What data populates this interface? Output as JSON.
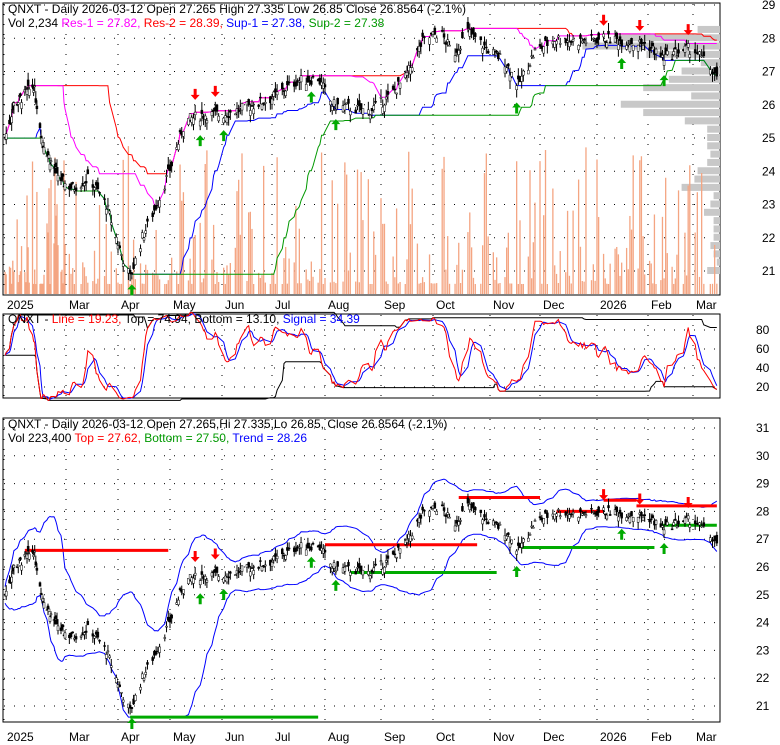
{
  "ticker": "QNXT",
  "panel1": {
    "line1": "QNXT - Daily 2026-03-12 Open 27.265  High 27.335  Low 26.85  Close 26.8564 (-2.1%)",
    "vol": "Vol 2,234 ",
    "res1": "Res-1 = 27.82, ",
    "res2": "Res-2 = 28.39, ",
    "sup1": "Sup-1 = 27.38, ",
    "sup2": "Sup-2 = 27.38",
    "yticks": [
      "29",
      "28",
      "27",
      "26",
      "25",
      "24",
      "23",
      "22",
      "21"
    ]
  },
  "panel2": {
    "name": "QNXT - ",
    "line": "Line = 19.23, ",
    "top": "Top = 74.94, ",
    "bottom": "Bottom = 13.10, ",
    "signal": "Signal = 34.39",
    "yticks": [
      "80",
      "60",
      "40",
      "20"
    ]
  },
  "panel3": {
    "line1": "QNXT - Daily 2026-03-12 Open 27.265,Hi 27.335,Lo 26.85, Close 26.8564 (-2.1%)",
    "vol": "Vol 223,400 ",
    "top": "Top = 27.62, ",
    "bottom": "Bottom = 27.50, ",
    "trend": "Trend = 28.26",
    "yticks": [
      "31",
      "30",
      "29",
      "28",
      "27",
      "26",
      "25",
      "24",
      "23",
      "22",
      "21"
    ]
  },
  "xlabels": [
    "2025",
    "Mar",
    "Apr",
    "May",
    "Jun",
    "Jul",
    "Aug",
    "Sep",
    "Oct",
    "Nov",
    "Dec",
    "2026",
    "Feb",
    "Mar"
  ],
  "colors": {
    "res1": "#ff00ff",
    "res2": "#ff0000",
    "sup1": "#0000ff",
    "sup2": "#009900",
    "up": "#00aa00",
    "down": "#ff0000"
  },
  "chart_data": {
    "type": "line",
    "title": "QNXT - Daily",
    "ylim_price": [
      20.5,
      29.2
    ],
    "ylim_oscillator": [
      0,
      90
    ],
    "series": [
      {
        "name": "Close",
        "points": [
          [
            "2025-01-02",
            25.0
          ],
          [
            "2025-01-10",
            26.0
          ],
          [
            "2025-01-20",
            26.3
          ],
          [
            "2025-01-28",
            26.6
          ],
          [
            "2025-02-05",
            25.0
          ],
          [
            "2025-02-15",
            24.2
          ],
          [
            "2025-02-25",
            23.7
          ],
          [
            "2025-03-05",
            23.5
          ],
          [
            "2025-03-15",
            23.8
          ],
          [
            "2025-03-25",
            23.0
          ],
          [
            "2025-04-03",
            21.5
          ],
          [
            "2025-04-08",
            20.8
          ],
          [
            "2025-04-15",
            22.0
          ],
          [
            "2025-04-25",
            23.2
          ],
          [
            "2025-05-02",
            24.2
          ],
          [
            "2025-05-10",
            25.5
          ],
          [
            "2025-05-20",
            25.7
          ],
          [
            "2025-06-01",
            25.7
          ],
          [
            "2025-06-15",
            25.9
          ],
          [
            "2025-07-01",
            26.2
          ],
          [
            "2025-07-15",
            26.7
          ],
          [
            "2025-07-28",
            26.8
          ],
          [
            "2025-08-05",
            26.0
          ],
          [
            "2025-08-15",
            25.9
          ],
          [
            "2025-08-25",
            25.8
          ],
          [
            "2025-09-05",
            26.2
          ],
          [
            "2025-09-15",
            26.8
          ],
          [
            "2025-09-25",
            27.9
          ],
          [
            "2025-10-05",
            28.2
          ],
          [
            "2025-10-12",
            27.5
          ],
          [
            "2025-10-20",
            28.2
          ],
          [
            "2025-10-30",
            27.7
          ],
          [
            "2025-11-10",
            27.3
          ],
          [
            "2025-11-18",
            26.6
          ],
          [
            "2025-11-28",
            27.6
          ],
          [
            "2025-12-10",
            28.0
          ],
          [
            "2025-12-20",
            27.9
          ],
          [
            "2026-01-05",
            28.0
          ],
          [
            "2026-01-20",
            27.9
          ],
          [
            "2026-02-01",
            27.8
          ],
          [
            "2026-02-10",
            27.4
          ],
          [
            "2026-02-20",
            27.6
          ],
          [
            "2026-03-01",
            27.7
          ],
          [
            "2026-03-12",
            26.86
          ]
        ]
      }
    ]
  }
}
